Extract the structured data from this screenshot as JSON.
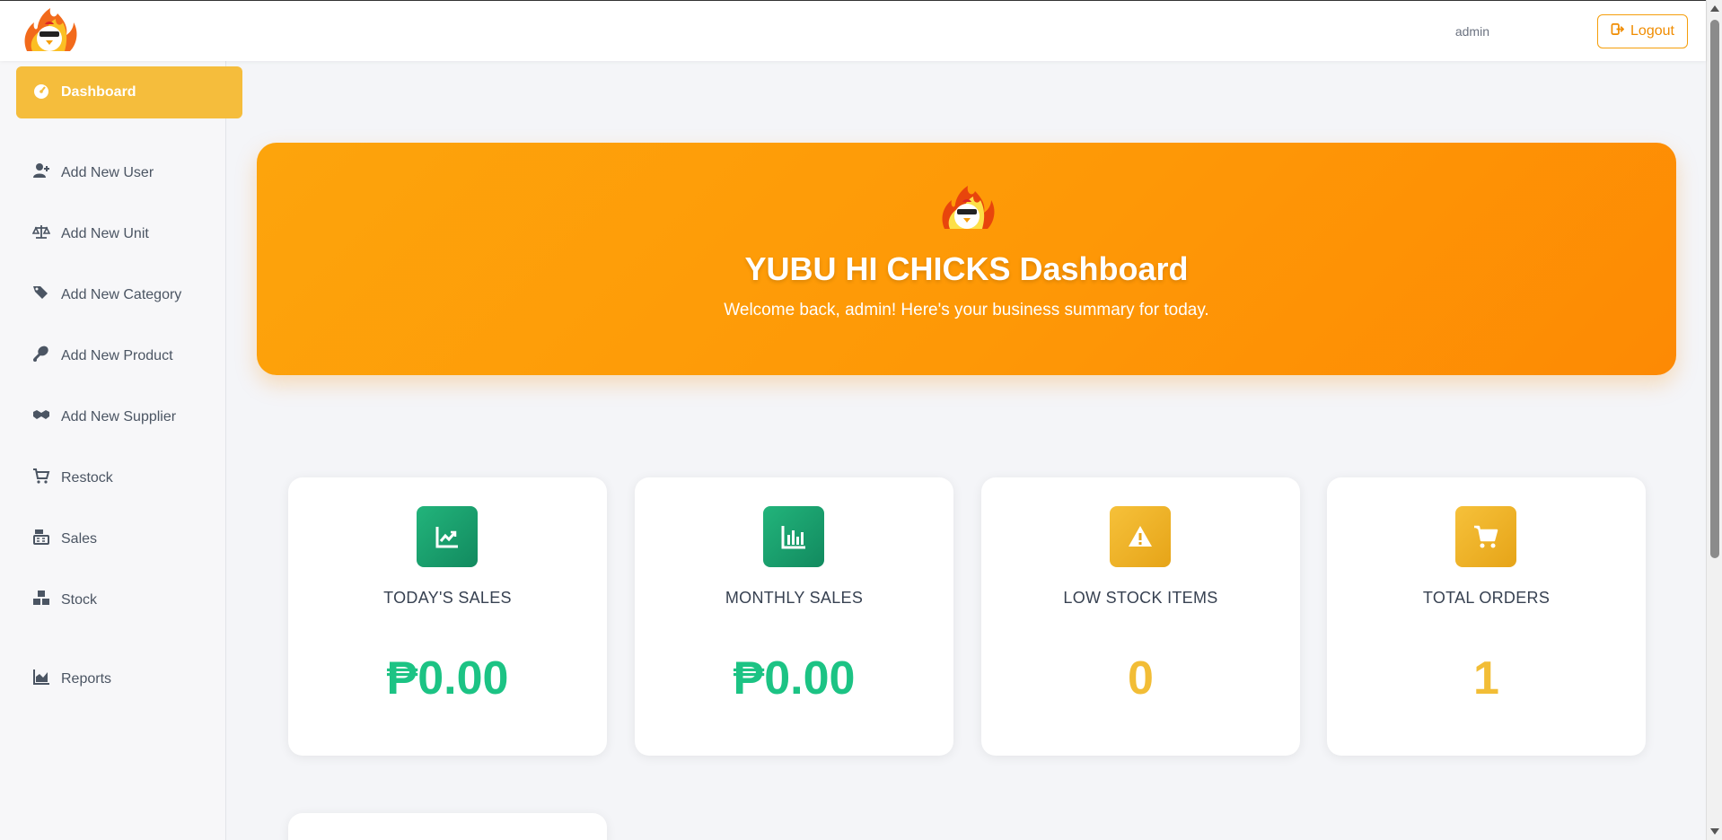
{
  "header": {
    "logo_icon": "flaming-chick-logo",
    "user_name": "admin",
    "logout_label": "Logout",
    "logout_icon": "sign-out-icon",
    "accent_color": "#f08c00"
  },
  "sidebar": {
    "items": [
      {
        "label": "Dashboard",
        "icon": "tachometer-icon",
        "active": true
      },
      {
        "label": "Add New User",
        "icon": "user-plus-icon"
      },
      {
        "label": "Add New Unit",
        "icon": "balance-scale-icon"
      },
      {
        "label": "Add New Category",
        "icon": "tags-icon"
      },
      {
        "label": "Add New Product",
        "icon": "drumstick-icon"
      },
      {
        "label": "Add New Supplier",
        "icon": "handshake-icon"
      },
      {
        "label": "Restock",
        "icon": "cart-icon"
      },
      {
        "label": "Sales",
        "icon": "cash-register-icon"
      },
      {
        "label": "Stock",
        "icon": "boxes-icon"
      },
      {
        "label": "Reports",
        "icon": "chart-area-icon"
      }
    ],
    "active_color": "#f5bd3c"
  },
  "hero": {
    "logo_icon": "flaming-chick-logo",
    "title": "YUBU HI CHICKS Dashboard",
    "subtitle": "Welcome back, admin! Here's your business summary for today.",
    "color": "#fe9806"
  },
  "cards": [
    {
      "label": "TODAY'S SALES",
      "value": "₱0.00",
      "icon": "chart-line-icon",
      "color": "#1cc384"
    },
    {
      "label": "MONTHLY SALES",
      "value": "₱0.00",
      "icon": "chart-bar-icon",
      "color": "#1cc384"
    },
    {
      "label": "LOW STOCK ITEMS",
      "value": "0",
      "icon": "warning-icon",
      "color": "#f2bd36"
    },
    {
      "label": "TOTAL ORDERS",
      "value": "1",
      "icon": "shopping-cart-icon",
      "color": "#f2bd36"
    }
  ]
}
